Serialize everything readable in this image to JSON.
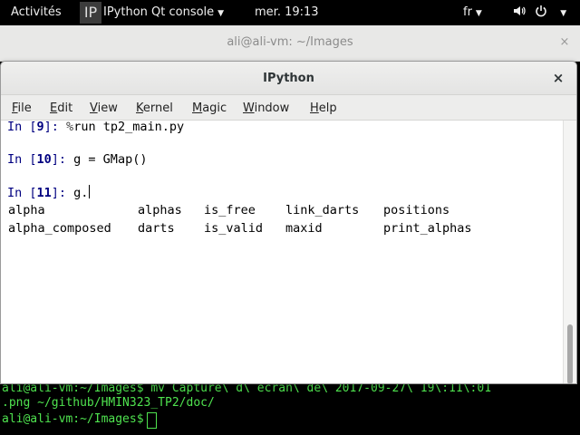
{
  "topbar": {
    "activities": "Activités",
    "app_logo": "IP",
    "app_name": "IPython Qt console",
    "clock": "mer. 19:13",
    "lang": "fr",
    "icons": [
      "volume-icon",
      "power-icon"
    ]
  },
  "terminal": {
    "title": "ali@ali-vm: ~/Images",
    "close": "×",
    "line1": "ali@ali-vm:~/Images$ mv Capture\\ d\\ écran\\ de\\ 2017-09-27\\ 19\\:11\\:01",
    "line2": ".png ~/github/HMIN323_TP2/doc/",
    "prompt": "ali@ali-vm:~/Images$"
  },
  "ipython": {
    "title": "IPython",
    "close": "×",
    "menu": [
      {
        "mnemonic": "F",
        "rest": "ile"
      },
      {
        "mnemonic": "E",
        "rest": "dit"
      },
      {
        "mnemonic": "V",
        "rest": "iew"
      },
      {
        "mnemonic": "K",
        "rest": "ernel"
      },
      {
        "mnemonic": "M",
        "rest": "agic"
      },
      {
        "mnemonic": "W",
        "rest": "indow"
      },
      {
        "mnemonic": "H",
        "rest": "elp"
      }
    ],
    "cells": [
      {
        "in": "In [",
        "num": "9",
        "close": "]: ",
        "code_a": "%",
        "code_b": "run tp2_main.py"
      },
      {
        "in": "In [",
        "num": "10",
        "close": "]: ",
        "code": "g = GMap()"
      },
      {
        "in": "In [",
        "num": "11",
        "close": "]: ",
        "code": "g."
      }
    ],
    "completions": [
      [
        "alpha",
        "alphas",
        "is_free",
        "link_darts",
        "positions"
      ],
      [
        "alpha_composed",
        "darts",
        "is_valid",
        "maxid",
        "print_alphas"
      ]
    ]
  },
  "colors": {
    "prompt": "#000080",
    "terminal_text": "#4fe34f",
    "desktop": "#000000"
  }
}
